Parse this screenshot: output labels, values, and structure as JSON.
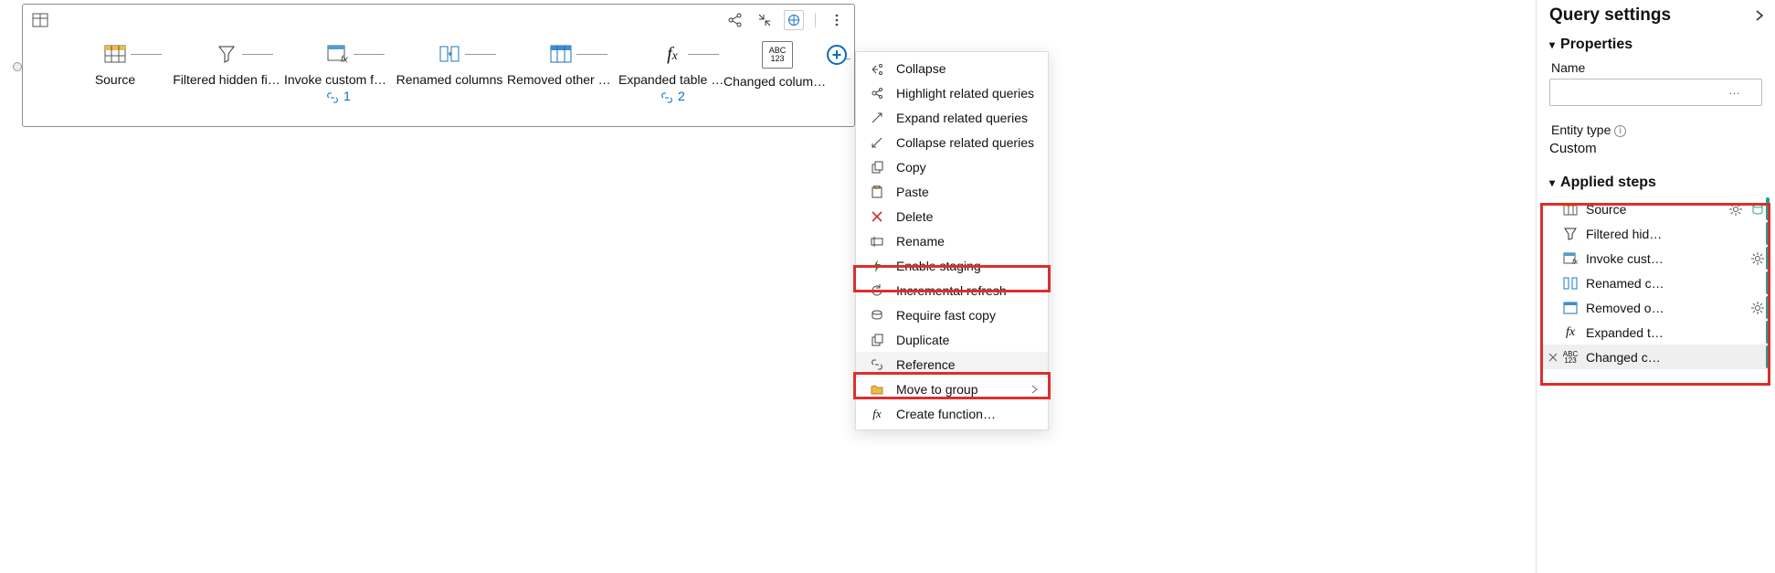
{
  "diagram": {
    "steps": [
      {
        "label": "Source",
        "icon": "table-yellow"
      },
      {
        "label": "Filtered hidden fi…",
        "icon": "funnel"
      },
      {
        "label": "Invoke custom fu…",
        "icon": "table-fx",
        "sub": "1"
      },
      {
        "label": "Renamed columns",
        "icon": "columns-rename"
      },
      {
        "label": "Removed other c…",
        "icon": "table-blue"
      },
      {
        "label": "Expanded table c…",
        "icon": "fx",
        "sub": "2"
      },
      {
        "label": "Changed column…",
        "icon": "abc123"
      }
    ]
  },
  "menu": [
    {
      "label": "Collapse",
      "icon": "collapse"
    },
    {
      "label": "Highlight related queries",
      "icon": "highlight"
    },
    {
      "label": "Expand related queries",
      "icon": "expand-rel"
    },
    {
      "label": "Collapse related queries",
      "icon": "collapse-rel"
    },
    {
      "label": "Copy",
      "icon": "copy"
    },
    {
      "label": "Paste",
      "icon": "paste"
    },
    {
      "label": "Delete",
      "icon": "delete"
    },
    {
      "label": "Rename",
      "icon": "rename"
    },
    {
      "label": "Enable staging",
      "icon": "bolt",
      "marked": true
    },
    {
      "label": "Incremental refresh",
      "icon": "refresh"
    },
    {
      "label": "Require fast copy",
      "icon": "fastcopy"
    },
    {
      "label": "Duplicate",
      "icon": "duplicate"
    },
    {
      "label": "Reference",
      "icon": "link",
      "marked": true,
      "hover": true
    },
    {
      "label": "Move to group",
      "icon": "folder",
      "sub": true
    },
    {
      "label": "Create function…",
      "icon": "fx-small"
    }
  ],
  "settings": {
    "title": "Query settings",
    "properties": {
      "header": "Properties",
      "name_label": "Name",
      "name_value": "",
      "entity_label": "Entity type",
      "entity_value": "Custom"
    },
    "applied": {
      "header": "Applied steps",
      "items": [
        {
          "label": "Source",
          "icon": "table-yellow",
          "gear": true,
          "db": true
        },
        {
          "label": "Filtered hid…",
          "icon": "funnel"
        },
        {
          "label": "Invoke cust…",
          "icon": "table-fx",
          "gear": true
        },
        {
          "label": "Renamed c…",
          "icon": "columns-rename"
        },
        {
          "label": "Removed o…",
          "icon": "table-blue",
          "gear": true
        },
        {
          "label": "Expanded t…",
          "icon": "fx"
        },
        {
          "label": "Changed c…",
          "icon": "abc123",
          "pre": "x",
          "selected": true
        }
      ]
    }
  }
}
